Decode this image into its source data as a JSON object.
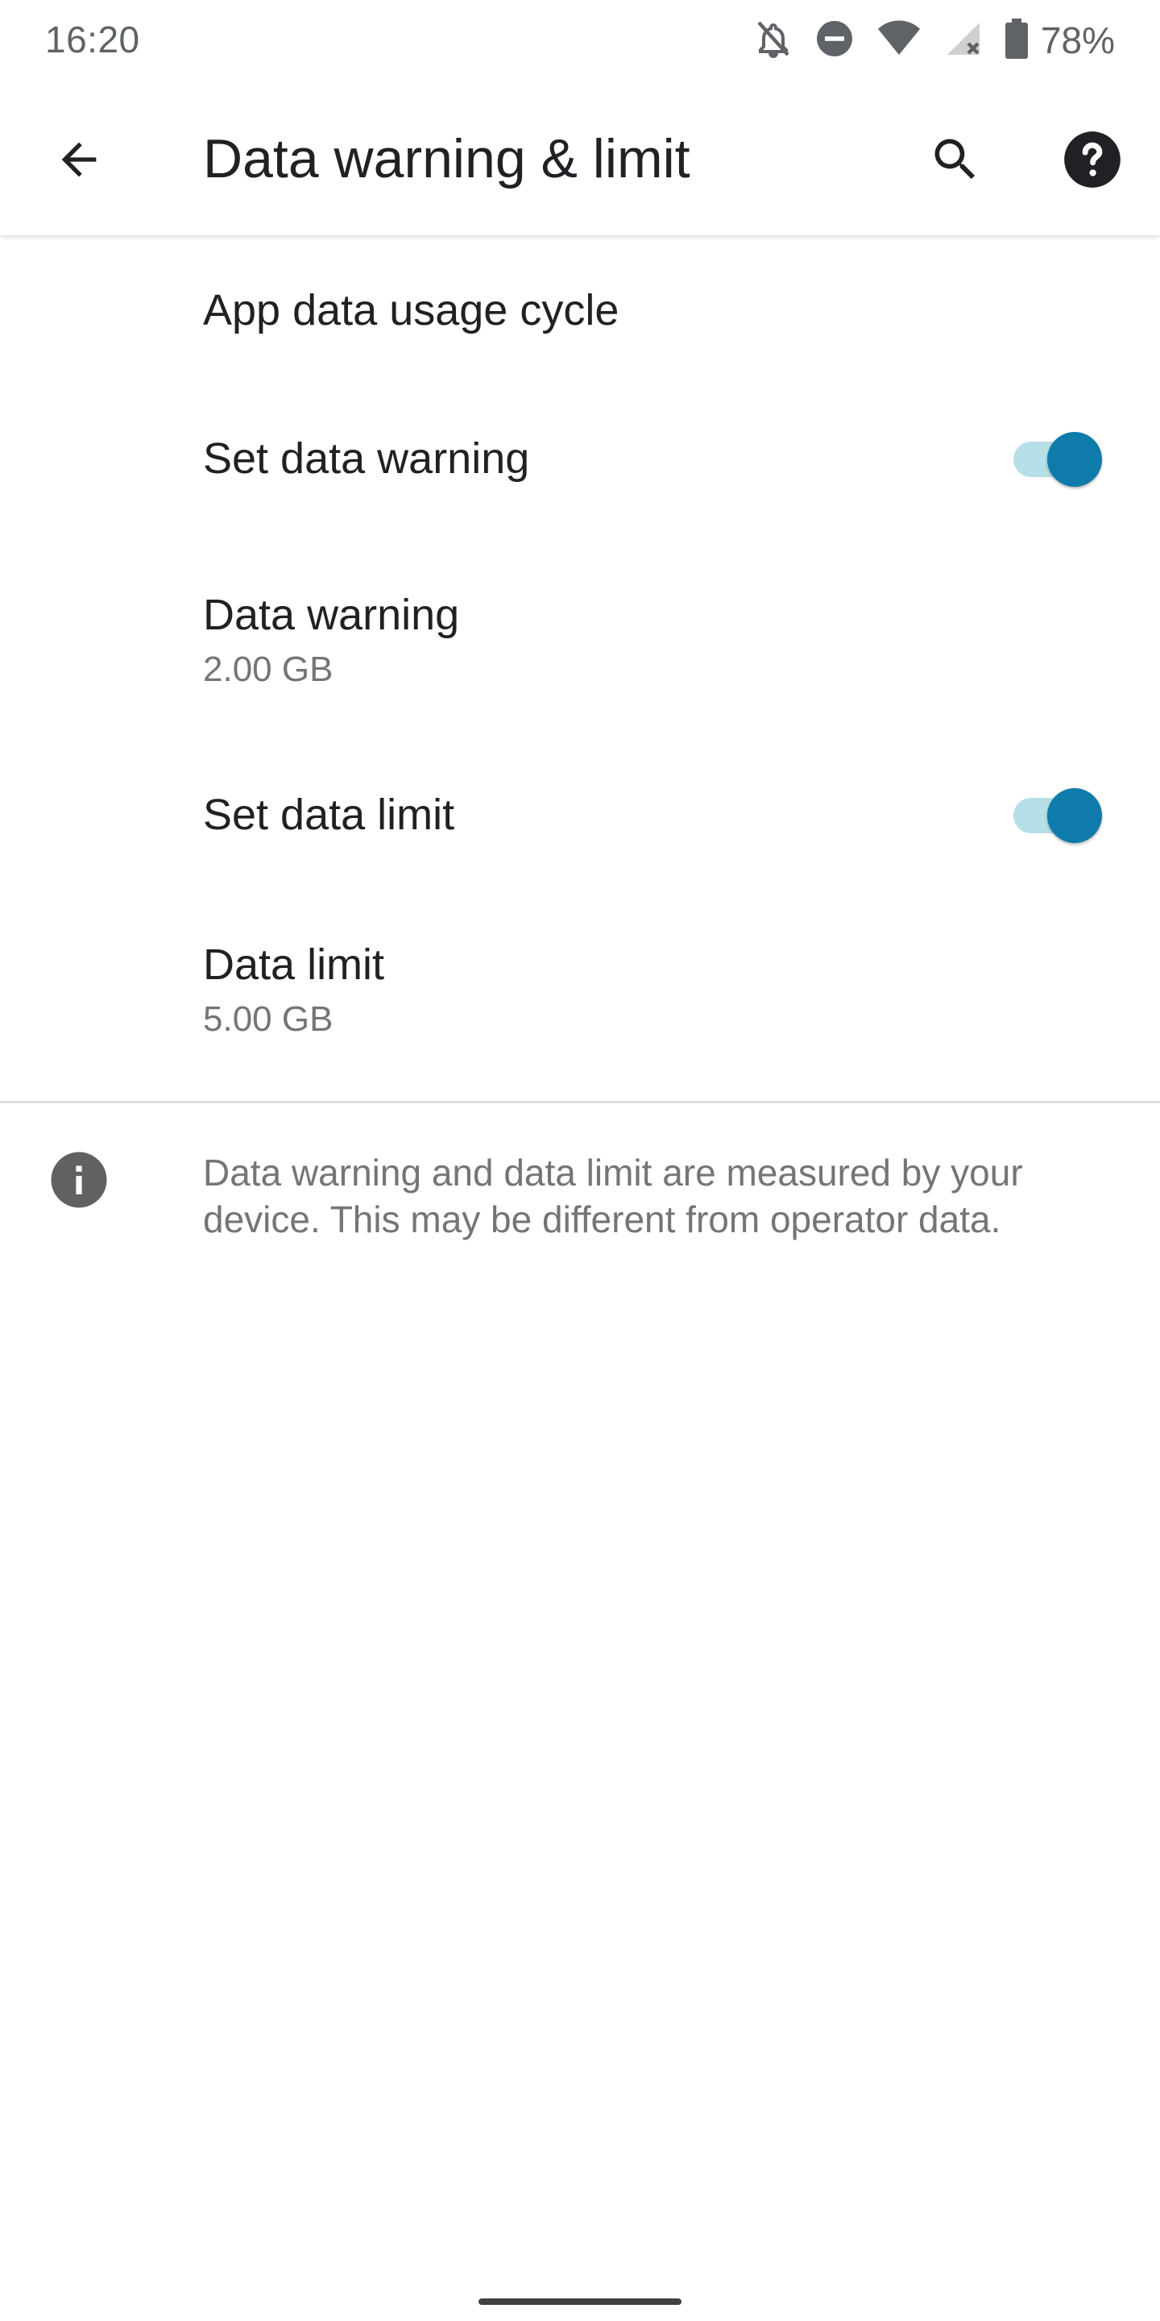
{
  "status_bar": {
    "time": "16:20",
    "icons": [
      "notifications-off-icon",
      "do-not-disturb-icon",
      "wifi-icon",
      "cellular-no-signal-icon",
      "battery-icon"
    ],
    "battery_percent": "78%"
  },
  "app_bar": {
    "title": "Data warning & limit",
    "icons": [
      "back-arrow-icon",
      "search-icon",
      "help-icon"
    ]
  },
  "settings": {
    "app_data_usage_cycle": {
      "title": "App data usage cycle"
    },
    "set_data_warning": {
      "title": "Set data warning",
      "enabled": true
    },
    "data_warning": {
      "title": "Data warning",
      "summary": "2.00 GB"
    },
    "set_data_limit": {
      "title": "Set data limit",
      "enabled": true
    },
    "data_limit": {
      "title": "Data limit",
      "summary": "5.00 GB"
    }
  },
  "footer": {
    "icon": "info-icon",
    "text": "Data warning and data limit are measured by your device. This may be different from operator data."
  },
  "colors": {
    "accent": "#0f7bab",
    "toggle_track": "#b7dfe8",
    "secondary_text": "#757575"
  }
}
